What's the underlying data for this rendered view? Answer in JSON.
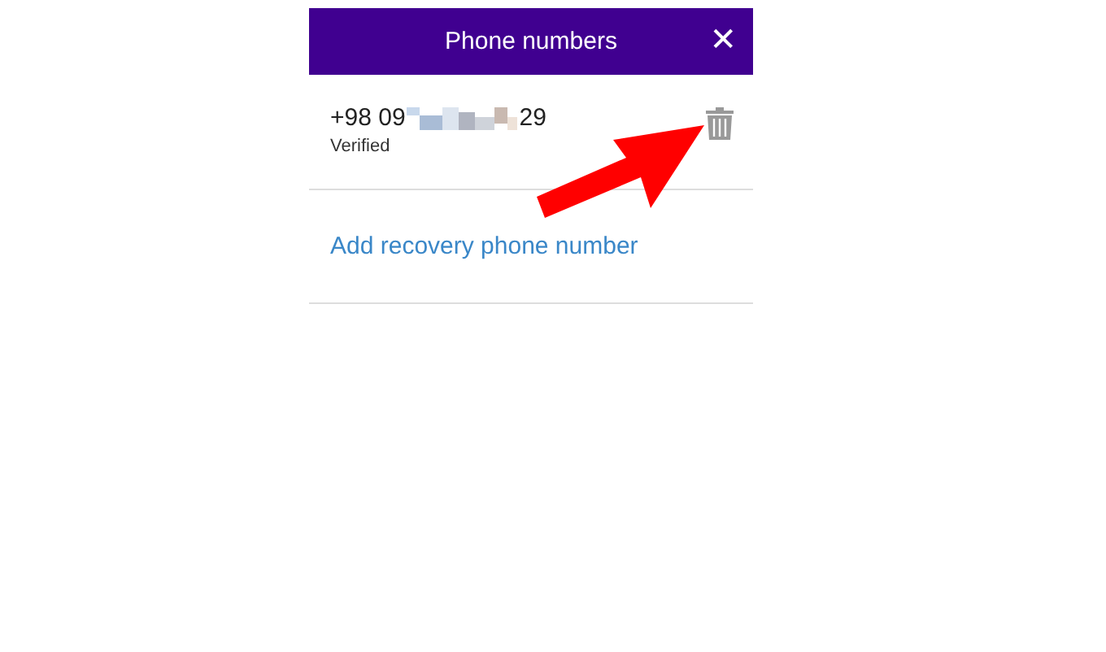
{
  "dialog": {
    "title": "Phone numbers",
    "close": "✕"
  },
  "phones": [
    {
      "prefix": "+98 09",
      "suffix": "29",
      "status": "Verified"
    }
  ],
  "add_link": "Add recovery phone number",
  "annotation": {
    "kind": "arrow"
  }
}
